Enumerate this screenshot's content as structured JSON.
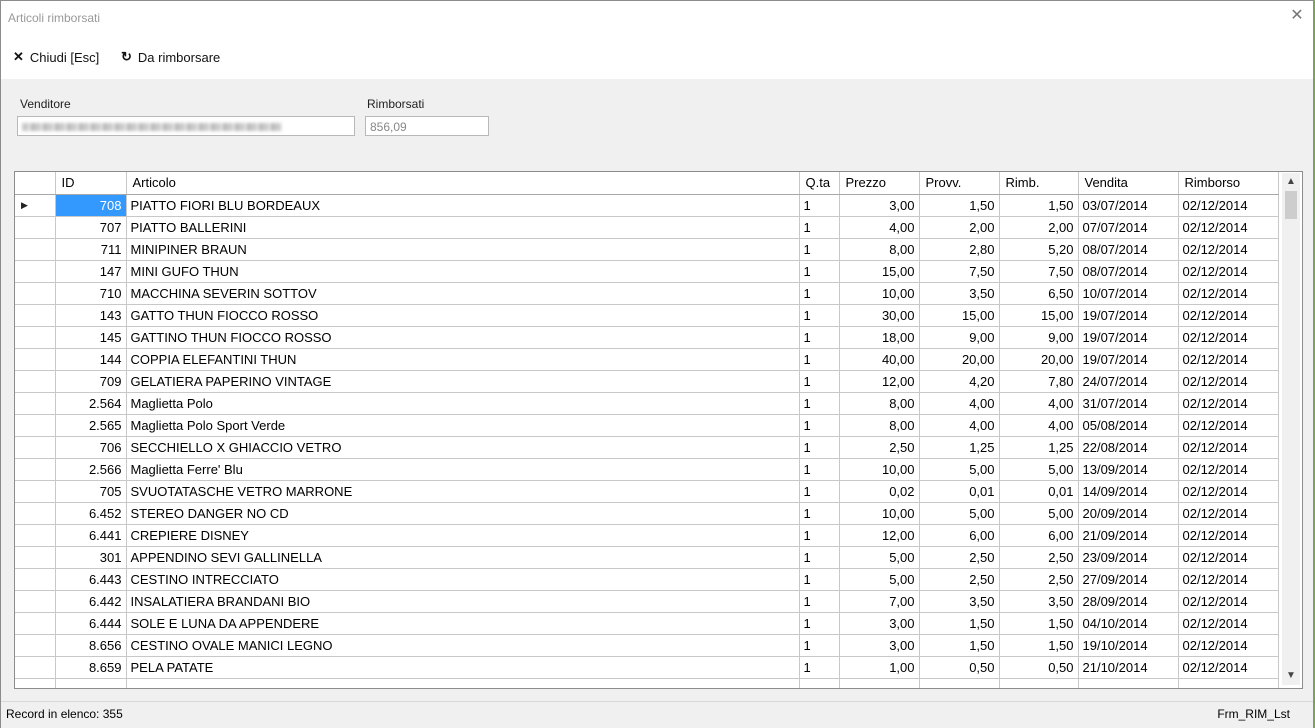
{
  "window": {
    "title": "Articoli rimborsati"
  },
  "toolbar": {
    "close_label": "Chiudi [Esc]",
    "refund_label": "Da rimborsare"
  },
  "form": {
    "venditore_label": "Venditore",
    "rimborsati_label": "Rimborsati",
    "rimborsati_value": "856,09"
  },
  "grid": {
    "columns": [
      "ID",
      "Articolo",
      "Q.ta",
      "Prezzo",
      "Provv.",
      "Rimb.",
      "Vendita",
      "Rimborso"
    ],
    "rows": [
      [
        "708",
        "PIATTO FIORI BLU BORDEAUX",
        "1",
        "3,00",
        "1,50",
        "1,50",
        "03/07/2014",
        "02/12/2014"
      ],
      [
        "707",
        "PIATTO BALLERINI",
        "1",
        "4,00",
        "2,00",
        "2,00",
        "07/07/2014",
        "02/12/2014"
      ],
      [
        "711",
        "MINIPINER BRAUN",
        "1",
        "8,00",
        "2,80",
        "5,20",
        "08/07/2014",
        "02/12/2014"
      ],
      [
        "147",
        "MINI GUFO THUN",
        "1",
        "15,00",
        "7,50",
        "7,50",
        "08/07/2014",
        "02/12/2014"
      ],
      [
        "710",
        "MACCHINA SEVERIN SOTTOV",
        "1",
        "10,00",
        "3,50",
        "6,50",
        "10/07/2014",
        "02/12/2014"
      ],
      [
        "143",
        "GATTO THUN FIOCCO ROSSO",
        "1",
        "30,00",
        "15,00",
        "15,00",
        "19/07/2014",
        "02/12/2014"
      ],
      [
        "145",
        "GATTINO THUN FIOCCO ROSSO",
        "1",
        "18,00",
        "9,00",
        "9,00",
        "19/07/2014",
        "02/12/2014"
      ],
      [
        "144",
        "COPPIA ELEFANTINI THUN",
        "1",
        "40,00",
        "20,00",
        "20,00",
        "19/07/2014",
        "02/12/2014"
      ],
      [
        "709",
        "GELATIERA PAPERINO VINTAGE",
        "1",
        "12,00",
        "4,20",
        "7,80",
        "24/07/2014",
        "02/12/2014"
      ],
      [
        "2.564",
        "Maglietta Polo",
        "1",
        "8,00",
        "4,00",
        "4,00",
        "31/07/2014",
        "02/12/2014"
      ],
      [
        "2.565",
        "Maglietta Polo Sport Verde",
        "1",
        "8,00",
        "4,00",
        "4,00",
        "05/08/2014",
        "02/12/2014"
      ],
      [
        "706",
        "SECCHIELLO X GHIACCIO VETRO",
        "1",
        "2,50",
        "1,25",
        "1,25",
        "22/08/2014",
        "02/12/2014"
      ],
      [
        "2.566",
        "Maglietta Ferre' Blu",
        "1",
        "10,00",
        "5,00",
        "5,00",
        "13/09/2014",
        "02/12/2014"
      ],
      [
        "705",
        "SVUOTATASCHE VETRO MARRONE",
        "1",
        "0,02",
        "0,01",
        "0,01",
        "14/09/2014",
        "02/12/2014"
      ],
      [
        "6.452",
        "STEREO DANGER NO CD",
        "1",
        "10,00",
        "5,00",
        "5,00",
        "20/09/2014",
        "02/12/2014"
      ],
      [
        "6.441",
        "CREPIERE DISNEY",
        "1",
        "12,00",
        "6,00",
        "6,00",
        "21/09/2014",
        "02/12/2014"
      ],
      [
        "301",
        "APPENDINO SEVI GALLINELLA",
        "1",
        "5,00",
        "2,50",
        "2,50",
        "23/09/2014",
        "02/12/2014"
      ],
      [
        "6.443",
        "CESTINO INTRECCIATO",
        "1",
        "5,00",
        "2,50",
        "2,50",
        "27/09/2014",
        "02/12/2014"
      ],
      [
        "6.442",
        "INSALATIERA BRANDANI BIO",
        "1",
        "7,00",
        "3,50",
        "3,50",
        "28/09/2014",
        "02/12/2014"
      ],
      [
        "6.444",
        "SOLE E LUNA DA APPENDERE",
        "1",
        "3,00",
        "1,50",
        "1,50",
        "04/10/2014",
        "02/12/2014"
      ],
      [
        "8.656",
        "CESTINO OVALE MANICI LEGNO",
        "1",
        "3,00",
        "1,50",
        "1,50",
        "19/10/2014",
        "02/12/2014"
      ],
      [
        "8.659",
        "PELA PATATE",
        "1",
        "1,00",
        "0,50",
        "0,50",
        "21/10/2014",
        "02/12/2014"
      ]
    ]
  },
  "status": {
    "record_count": "Record in elenco: 355",
    "form_name": "Frm_RIM_Lst"
  },
  "icons": {
    "close": "close-x-icon",
    "refund": "refresh-icon",
    "row_indicator": "triangle-right-icon"
  }
}
